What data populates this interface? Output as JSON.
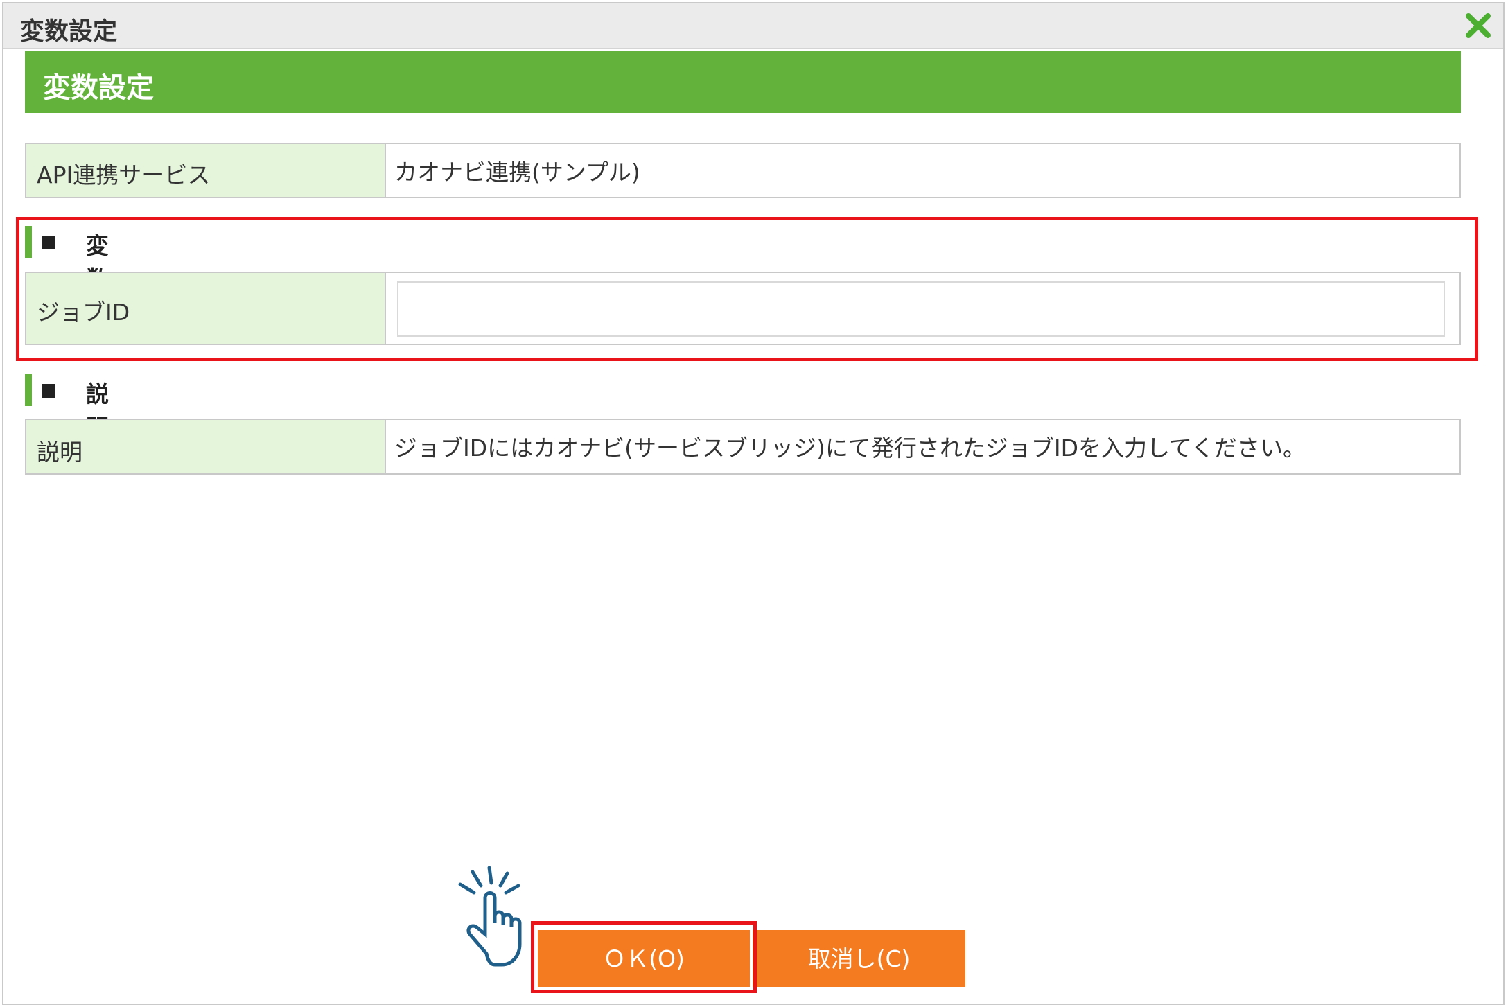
{
  "window": {
    "title": "変数設定"
  },
  "header": {
    "title": "変数設定"
  },
  "api_row": {
    "label": "API連携サービス",
    "value": "カオナビ連携(サンプル)"
  },
  "variables_section": {
    "heading": "変数",
    "job_id_label": "ジョブID",
    "job_id_value": ""
  },
  "description_section": {
    "heading": "説明",
    "label": "説明",
    "text": "ジョブIDにはカオナビ(サービスブリッジ)にて発行されたジョブIDを入力してください。"
  },
  "buttons": {
    "ok": "ＯＫ(O)",
    "cancel": "取消し(C)"
  },
  "icons": [
    "close-icon",
    "pointer-hand-icon"
  ],
  "colors": {
    "accent_green": "#63b23c",
    "label_bg": "#e4f5dc",
    "button_orange": "#f47b20",
    "highlight_red": "#e8141a"
  }
}
